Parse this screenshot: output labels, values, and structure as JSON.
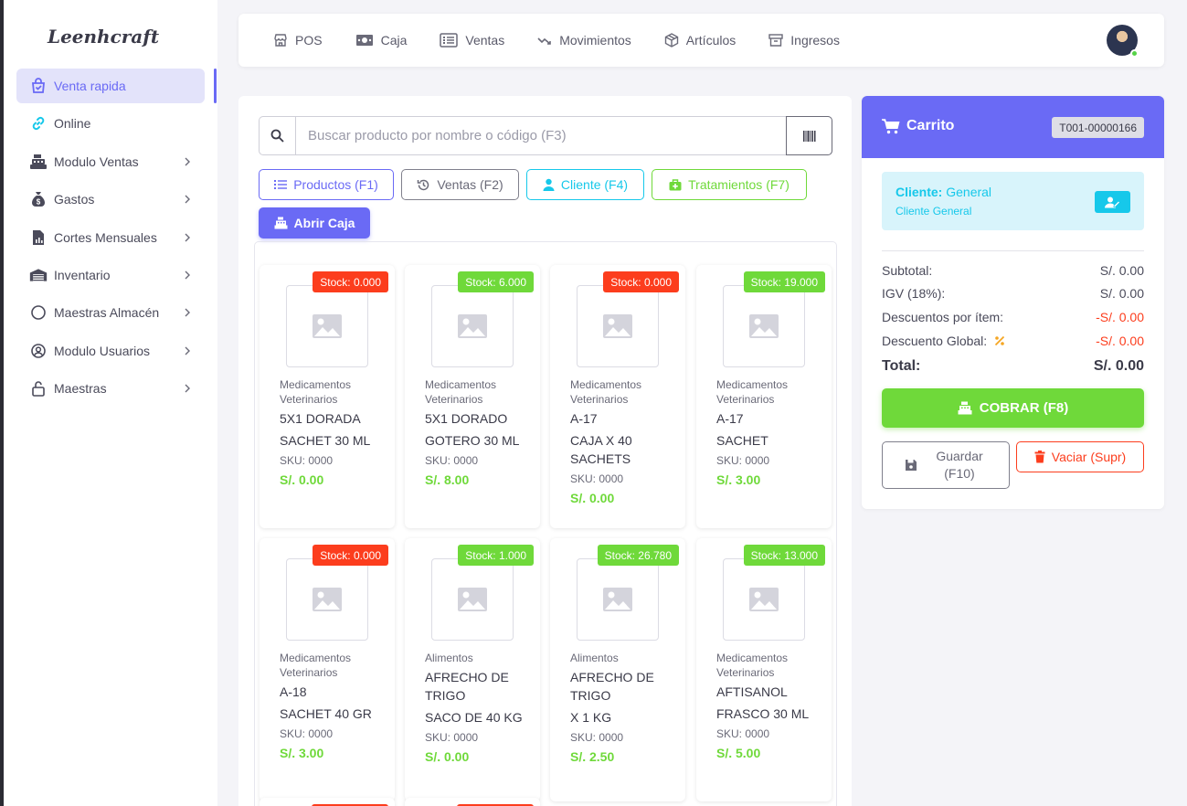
{
  "app": {
    "logo": "Leenhcraft"
  },
  "sidebar": {
    "items": [
      {
        "label": "Venta rapida",
        "icon": "shopping-bag-icon"
      },
      {
        "label": "Online",
        "icon": "link-icon"
      },
      {
        "label": "Modulo Ventas",
        "icon": "cash-register-icon"
      },
      {
        "label": "Gastos",
        "icon": "money-bag-icon"
      },
      {
        "label": "Cortes Mensuales",
        "icon": "report-file-icon"
      },
      {
        "label": "Inventario",
        "icon": "warehouse-icon"
      },
      {
        "label": "Maestras Almacén",
        "icon": "circle-icon"
      },
      {
        "label": "Modulo Usuarios",
        "icon": "user-circle-icon"
      },
      {
        "label": "Maestras",
        "icon": "lock-icon"
      }
    ]
  },
  "topnav": {
    "items": [
      {
        "label": "POS",
        "icon": "store-icon"
      },
      {
        "label": "Caja",
        "icon": "cash-icon"
      },
      {
        "label": "Ventas",
        "icon": "list-icon"
      },
      {
        "label": "Movimientos",
        "icon": "trend-icon"
      },
      {
        "label": "Artículos",
        "icon": "box-icon"
      },
      {
        "label": "Ingresos",
        "icon": "archive-icon"
      }
    ]
  },
  "search": {
    "placeholder": "Buscar producto por nombre o código (F3)",
    "value": ""
  },
  "buttons": {
    "productos": "Productos (F1)",
    "ventas": "Ventas (F2)",
    "cliente": "Cliente (F4)",
    "tratamientos": "Tratamientos (F7)",
    "abrir_caja": "Abrir Caja"
  },
  "products": [
    {
      "stock": "Stock: 0.000",
      "stock_status": "out",
      "category": "Medicamentos Veterinarios",
      "name1": "5X1 DORADA",
      "name2": "SACHET 30 ML",
      "sku": "SKU: 0000",
      "price": "S/. 0.00"
    },
    {
      "stock": "Stock: 6.000",
      "stock_status": "in",
      "category": "Medicamentos Veterinarios",
      "name1": "5X1 DORADO",
      "name2": "GOTERO 30 ML",
      "sku": "SKU: 0000",
      "price": "S/. 8.00"
    },
    {
      "stock": "Stock: 0.000",
      "stock_status": "out",
      "category": "Medicamentos Veterinarios",
      "name1": "A-17",
      "name2": "CAJA X 40 SACHETS",
      "sku": "SKU: 0000",
      "price": "S/. 0.00"
    },
    {
      "stock": "Stock: 19.000",
      "stock_status": "in",
      "category": "Medicamentos Veterinarios",
      "name1": "A-17",
      "name2": "SACHET",
      "sku": "SKU: 0000",
      "price": "S/. 3.00"
    },
    {
      "stock": "Stock: 0.000",
      "stock_status": "out",
      "category": "Medicamentos Veterinarios",
      "name1": "A-18",
      "name2": "SACHET 40 GR",
      "sku": "SKU: 0000",
      "price": "S/. 3.00"
    },
    {
      "stock": "Stock: 1.000",
      "stock_status": "in",
      "category": "Alimentos",
      "name1": "AFRECHO DE TRIGO",
      "name2": "SACO DE 40 KG",
      "sku": "SKU: 0000",
      "price": "S/. 0.00"
    },
    {
      "stock": "Stock: 26.780",
      "stock_status": "in",
      "category": "Alimentos",
      "name1": "AFRECHO DE TRIGO",
      "name2": "X 1 KG",
      "sku": "SKU: 0000",
      "price": "S/. 2.50"
    },
    {
      "stock": "Stock: 13.000",
      "stock_status": "in",
      "category": "Medicamentos Veterinarios",
      "name1": "AFTISANOL",
      "name2": "FRASCO 30 ML",
      "sku": "SKU: 0000",
      "price": "S/. 5.00"
    }
  ],
  "cart": {
    "title": "Carrito",
    "ticket": "T001-00000166",
    "client_label": "Cliente:",
    "client_name": "General",
    "client_sub": "Cliente General",
    "subtotal_label": "Subtotal:",
    "subtotal": "S/. 0.00",
    "igv_label": "IGV (18%):",
    "igv": "S/. 0.00",
    "desc_item_label": "Descuentos por ítem:",
    "desc_item": "-S/. 0.00",
    "desc_global_label": "Descuento Global:",
    "desc_global": "-S/. 0.00",
    "total_label": "Total:",
    "total": "S/. 0.00",
    "cobrar": "COBRAR (F8)",
    "guardar": "Guardar (F10)",
    "vaciar": "Vaciar (Supr)"
  },
  "colors": {
    "primary": "#6a6af5",
    "success": "#6fd93a",
    "info": "#16c8ea",
    "danger": "#fc3d1d"
  }
}
